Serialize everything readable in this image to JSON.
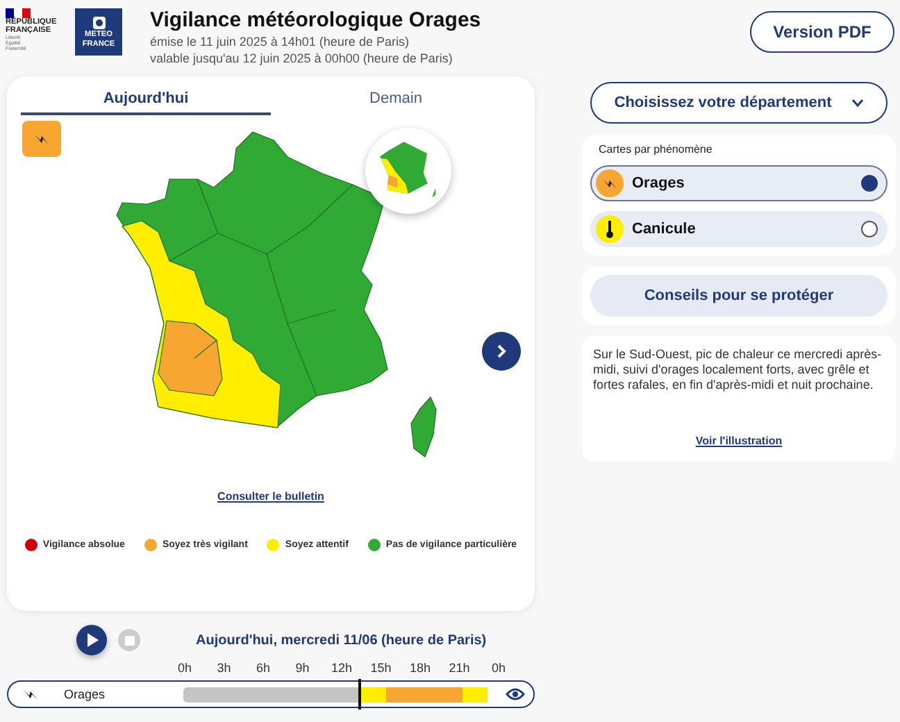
{
  "header": {
    "republic_lines": [
      "RÉPUBLIQUE",
      "FRANÇAISE"
    ],
    "motto": "Liberté Égalité Fraternité",
    "logo_lines": [
      "METEO",
      "FRANCE"
    ],
    "title": "Vigilance météorologique Orages",
    "issued": "émise le 11 juin 2025 à 14h01 (heure de Paris)",
    "valid": "valable jusqu'au 12 juin 2025 à 00h00 (heure de Paris)",
    "pdf_button": "Version PDF"
  },
  "map_card": {
    "tabs": [
      {
        "label": "Aujourd'hui",
        "selected": true
      },
      {
        "label": "Demain",
        "selected": false
      }
    ],
    "bulletin_link": "Consulter le bulletin",
    "legend": [
      {
        "label": "Vigilance absolue",
        "color": "#cc0000"
      },
      {
        "label": "Soyez très vigilant",
        "color": "#f7a731"
      },
      {
        "label": "Soyez attentif",
        "color": "#ffee00"
      },
      {
        "label": "Pas de vigilance particulière",
        "color": "#31aa35"
      }
    ]
  },
  "timeline": {
    "date": "Aujourd'hui, mercredi 11/06 (heure de Paris)",
    "hours": [
      "0h",
      "3h",
      "6h",
      "9h",
      "12h",
      "15h",
      "18h",
      "21h",
      "0h"
    ],
    "track_label": "Orages"
  },
  "sidebar": {
    "department_select": "Choisissez votre département",
    "phenomena_title": "Cartes par phénomène",
    "phenomena": [
      {
        "label": "Orages",
        "kind": "storm",
        "color": "#f7a731",
        "selected": true
      },
      {
        "label": "Canicule",
        "kind": "heat",
        "color": "#ffee00",
        "selected": false
      }
    ],
    "advice_button": "Conseils pour se protéger",
    "description": "Sur le Sud-Ouest, pic de chaleur ce mercredi après-midi, suivi d'orages localement forts, avec grêle et fortes rafales, en fin d'après-midi et nuit prochaine.",
    "illustration_link": "Voir l'illustration"
  }
}
